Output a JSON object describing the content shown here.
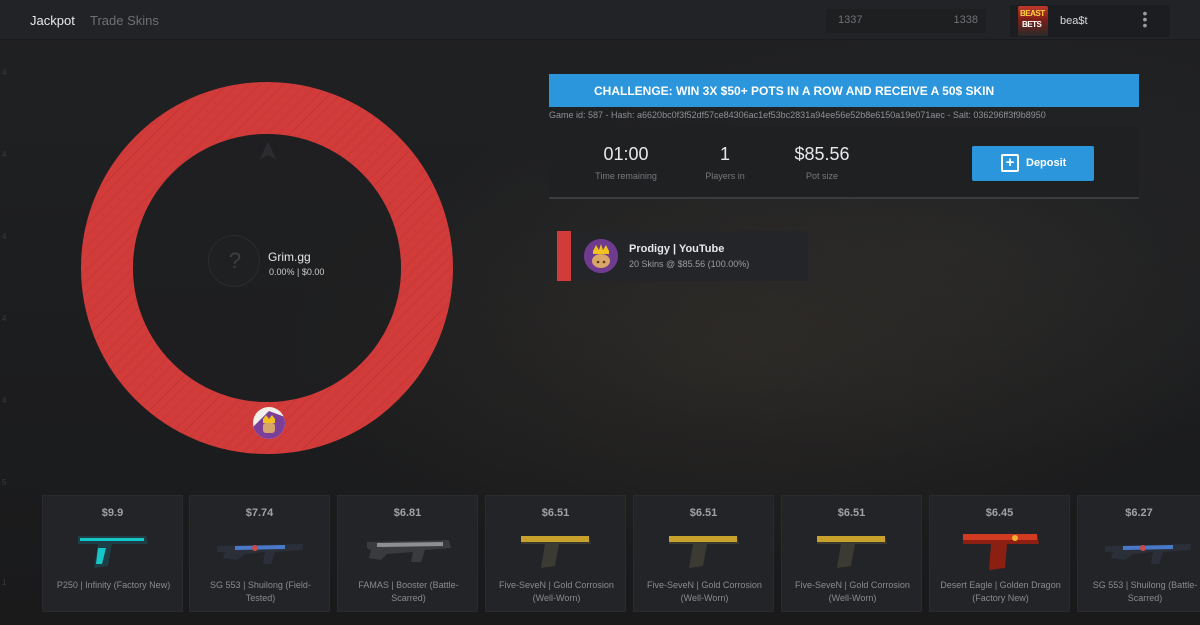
{
  "nav": {
    "jackpot": "Jackpot",
    "trade_skins": "Trade Skins"
  },
  "range": {
    "low": "1337",
    "high": "1338"
  },
  "user": {
    "name": "bea$t",
    "avatar_text_top": "BEAST",
    "avatar_text_bottom": "BETS",
    "menu_icon": "kebab-menu-icon"
  },
  "wheel": {
    "color": "#d13c3b",
    "center_placeholder": "?",
    "winner_name": "Grim.gg",
    "winner_stats": "0.00% | $0.00",
    "pointer_icon": "arrow-up-icon"
  },
  "challenge": {
    "text": "CHALLENGE: WIN 3X $50+ POTS IN A ROW AND RECEIVE A 50$ SKIN",
    "color": "#2b96db"
  },
  "game_hash": "Game id: 587 - Hash: a6620bc0f3f52df57ce84306ac1ef53bc2831a94ee56e52b8e6150a19e071aec - Salt: 036296ff3f9b8950",
  "stats": {
    "time_value": "01:00",
    "time_label": "Time remaining",
    "players_value": "1",
    "players_label": "Players in",
    "pot_value": "$85.56",
    "pot_label": "Pot size"
  },
  "deposit": {
    "label": "Deposit",
    "icon": "plus-square-icon"
  },
  "player": {
    "name": "Prodigy | YouTube",
    "info": "20 Skins @ $85.56 (100.00%)",
    "color": "#d13c3b"
  },
  "skins": [
    {
      "price": "$9.9",
      "name": "P250 | Infinity (Factory New)",
      "color": "#16c7c9"
    },
    {
      "price": "$7.74",
      "name": "SG 553 | Shuilong (Field-Tested)",
      "color": "#4a79c9"
    },
    {
      "price": "$6.81",
      "name": "FAMAS | Booster (Battle-Scarred)",
      "color": "#8e8f92"
    },
    {
      "price": "$6.51",
      "name": "Five-SeveN | Gold Corrosion (Well-Worn)",
      "color": "#c8a22a"
    },
    {
      "price": "$6.51",
      "name": "Five-SeveN | Gold Corrosion (Well-Worn)",
      "color": "#c8a22a"
    },
    {
      "price": "$6.51",
      "name": "Five-SeveN | Gold Corrosion (Well-Worn)",
      "color": "#c8a22a"
    },
    {
      "price": "$6.45",
      "name": "Desert Eagle | Golden Dragon (Factory New)",
      "color": "#d23a22"
    },
    {
      "price": "$6.27",
      "name": "SG 553 | Shuilong (Battle-Scarred)",
      "color": "#4a79c9"
    }
  ]
}
